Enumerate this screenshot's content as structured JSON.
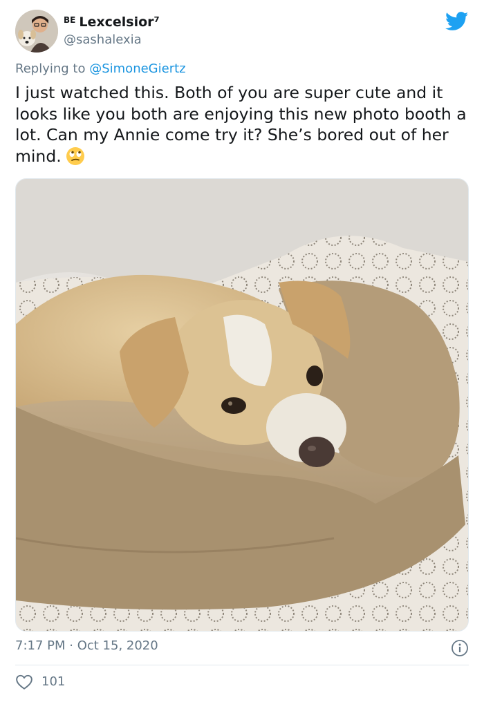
{
  "tweet": {
    "display_name": "Lexcelsior⁷",
    "badge_prefix": "BE",
    "handle": "@sashalexia",
    "reply_prefix": "Replying to",
    "reply_to": "@SimoneGiertz",
    "text": "I just watched this. Both of you are super cute and it looks like you both are enjoying this new photo booth a lot. Can my Annie come try it? She’s bored out of her mind.",
    "emoji": "face-with-rolling-eyes",
    "image": "photo of a tan dog curled up in a beige blanket on a patterned bedsheet",
    "timestamp": "7:17 PM · Oct 15, 2020",
    "like_count": "101"
  },
  "colors": {
    "brand": "#1da1f2",
    "link": "#1b95e0",
    "secondary_text": "#657786",
    "divider": "#e1e8ed"
  },
  "icons": {
    "brand": "twitter-bird-icon",
    "info": "info-icon",
    "like": "heart-icon"
  }
}
